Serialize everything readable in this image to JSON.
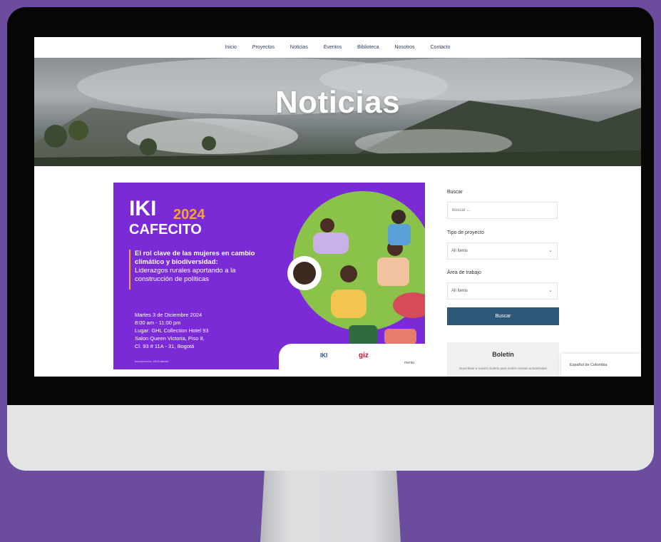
{
  "nav": {
    "items": [
      "Inicio",
      "Proyectos",
      "Noticias",
      "Eventos",
      "Biblioteca",
      "Nosotros",
      "Contacto"
    ]
  },
  "hero": {
    "title": "Noticias"
  },
  "banner": {
    "title": "IKI",
    "year": "2024",
    "subtitle": "CAFECITO",
    "desc_bold": "El rol clave de las mujeres en cambio climático y biodiversidad:",
    "desc": "Liderazgos rurales aportando a la construcción de políticas",
    "details": [
      "Martes 3 de Diciembre 2024",
      "8:00 am - 11:00 pm",
      "Lugar: GHL Collection Hotel 93",
      "Salon Queen Victoria, Piso 8,",
      "Cl. 93 # 11A - 31, Bogotá"
    ],
    "footnote": "Inscripciones: #IKICafecito",
    "logos": {
      "iki": "IKI",
      "giz": "giz",
      "last": "menta"
    }
  },
  "sidebar": {
    "search_label": "Buscar",
    "search_placeholder": "Buscar ...",
    "tipo_label": "Tipo de proyecto",
    "tipo_value": "All Items",
    "area_label": "Área de trabajo",
    "area_value": "All Items",
    "button": "Buscar",
    "boletin_title": "Boletín",
    "boletin_desc": "Suscríbete a nuestro boletín para recibir noticias actualizadas"
  },
  "language": {
    "label": "Español de Colombia"
  },
  "colors": {
    "background": "#6b4c9e",
    "banner_purple": "#7a2bd6",
    "accent_orange": "#f5a623",
    "button_blue": "#2e5877"
  },
  "icons": [
    "chevron-down-icon",
    "coffee-cup-icon"
  ]
}
